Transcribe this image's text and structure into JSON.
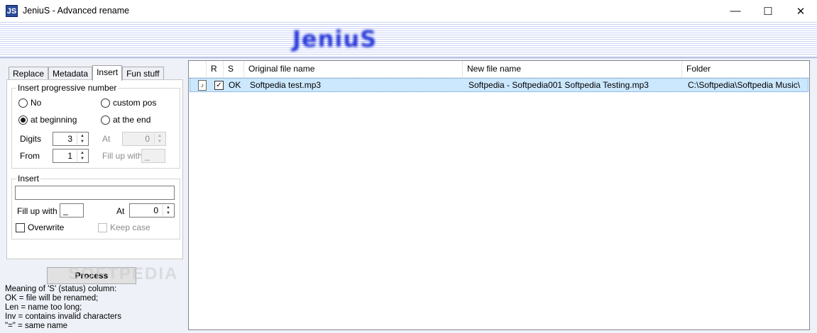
{
  "window": {
    "icon_text": "JS",
    "title": "JeniuS - Advanced rename",
    "minimize_glyph": "—",
    "maximize_glyph": "☐",
    "close_glyph": "✕"
  },
  "banner": {
    "logo_text": "JeniuS"
  },
  "tabs": [
    "Replace",
    "Metadata",
    "Insert",
    "Fun stuff"
  ],
  "active_tab": "Insert",
  "progressive": {
    "group_label": "Insert progressive number",
    "option_no": "No",
    "option_custom_pos": "custom pos",
    "option_at_beginning": "at beginning",
    "option_at_the_end": "at the end",
    "selected": "at beginning",
    "digits_label": "Digits",
    "digits_value": "3",
    "from_label": "From",
    "from_value": "1",
    "at_label": "At",
    "at_value": "0",
    "fill_up_label": "Fill up with",
    "fill_up_value": "_"
  },
  "insert": {
    "group_label": "Insert",
    "text_value": "",
    "fill_up_label": "Fill up with",
    "fill_up_value": "_",
    "at_label": "At",
    "at_value": "0",
    "overwrite_label": "Overwrite",
    "keep_case_label": "Keep case"
  },
  "process_button": "Process",
  "watermark": "SOFTPEDIA",
  "legend": [
    "Meaning of 'S' (status) column:",
    "OK = file will be renamed;",
    "Len = name too long;",
    "Inv = contains invalid characters",
    "\"=\" = same name"
  ],
  "grid": {
    "columns": [
      "R",
      "S",
      "Original file name",
      "New file name",
      "Folder"
    ],
    "rows": [
      {
        "icon": "music-file-icon",
        "checked": true,
        "status": "OK",
        "original": "Softpedia test.mp3",
        "new_name": "Softpedia - Softpedia001 Softpedia Testing.mp3",
        "folder": "C:\\Softpedia\\Softpedia Music\\"
      }
    ]
  }
}
